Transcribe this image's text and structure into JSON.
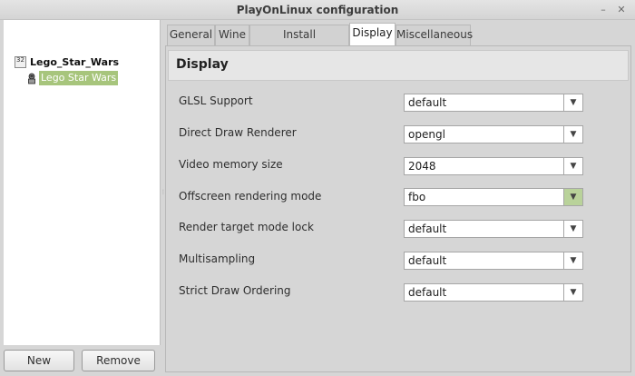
{
  "window": {
    "title": "PlayOnLinux configuration",
    "min_glyph": "–",
    "close_glyph": "✕"
  },
  "sidebar": {
    "root_icon_text": "32",
    "root_label": "Lego_Star_Wars",
    "child_label": "Lego Star Wars"
  },
  "buttons": {
    "new": "New",
    "remove": "Remove"
  },
  "tabs": [
    "General",
    "Wine",
    "Install components",
    "Display",
    "Miscellaneous"
  ],
  "active_tab": "Display",
  "section_title": "Display",
  "settings": [
    {
      "label": "GLSL Support",
      "value": "default"
    },
    {
      "label": "Direct Draw Renderer",
      "value": "opengl"
    },
    {
      "label": "Video memory size",
      "value": "2048"
    },
    {
      "label": "Offscreen rendering mode",
      "value": "fbo"
    },
    {
      "label": "Render target mode lock",
      "value": "default"
    },
    {
      "label": "Multisampling",
      "value": "default"
    },
    {
      "label": "Strict Draw Ordering",
      "value": "default"
    }
  ],
  "icons": {
    "dropdown": "chevron-down-icon"
  },
  "colors": {
    "selection": "#a7c57c",
    "hover_arrow": "#b9d29a"
  }
}
